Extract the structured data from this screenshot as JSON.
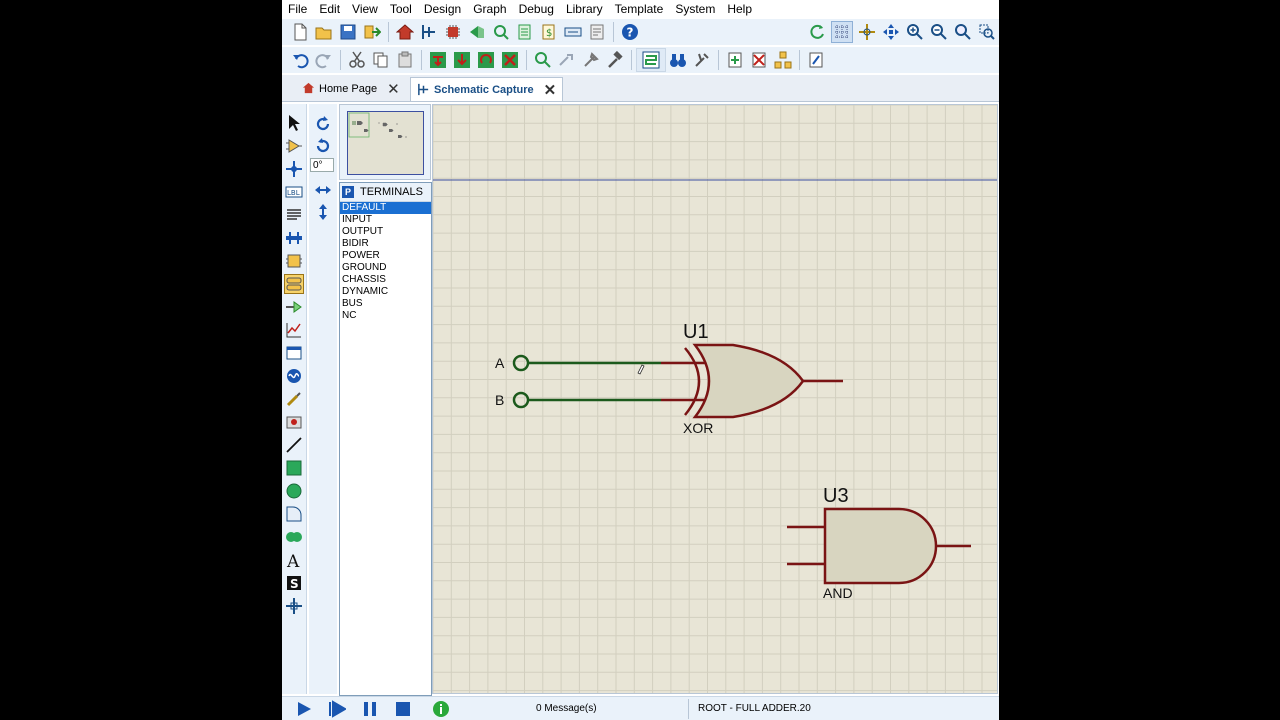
{
  "menu": [
    "File",
    "Edit",
    "View",
    "Tool",
    "Design",
    "Graph",
    "Debug",
    "Library",
    "Template",
    "System",
    "Help"
  ],
  "tabs": {
    "home": "Home Page",
    "schematic": "Schematic Capture"
  },
  "rotation": {
    "angle": "0°"
  },
  "device_panel": {
    "header_letter": "P",
    "title": "TERMINALS",
    "items": [
      "DEFAULT",
      "INPUT",
      "OUTPUT",
      "BIDIR",
      "POWER",
      "GROUND",
      "CHASSIS",
      "DYNAMIC",
      "BUS",
      "NC"
    ],
    "selected": "DEFAULT"
  },
  "schematic": {
    "xor": {
      "ref": "U1",
      "type": "XOR"
    },
    "and": {
      "ref": "U3",
      "type": "AND"
    },
    "input_a": "A",
    "input_b": "B"
  },
  "status": {
    "messages": "0 Message(s)",
    "root": "ROOT - FULL ADDER.20"
  },
  "colors": {
    "canvas": "#e8e5d6",
    "gate_stroke": "#7a1414",
    "gate_fill": "#d8d5c0",
    "wire": "#1c5a1c",
    "grid": "#d2cfbf"
  }
}
